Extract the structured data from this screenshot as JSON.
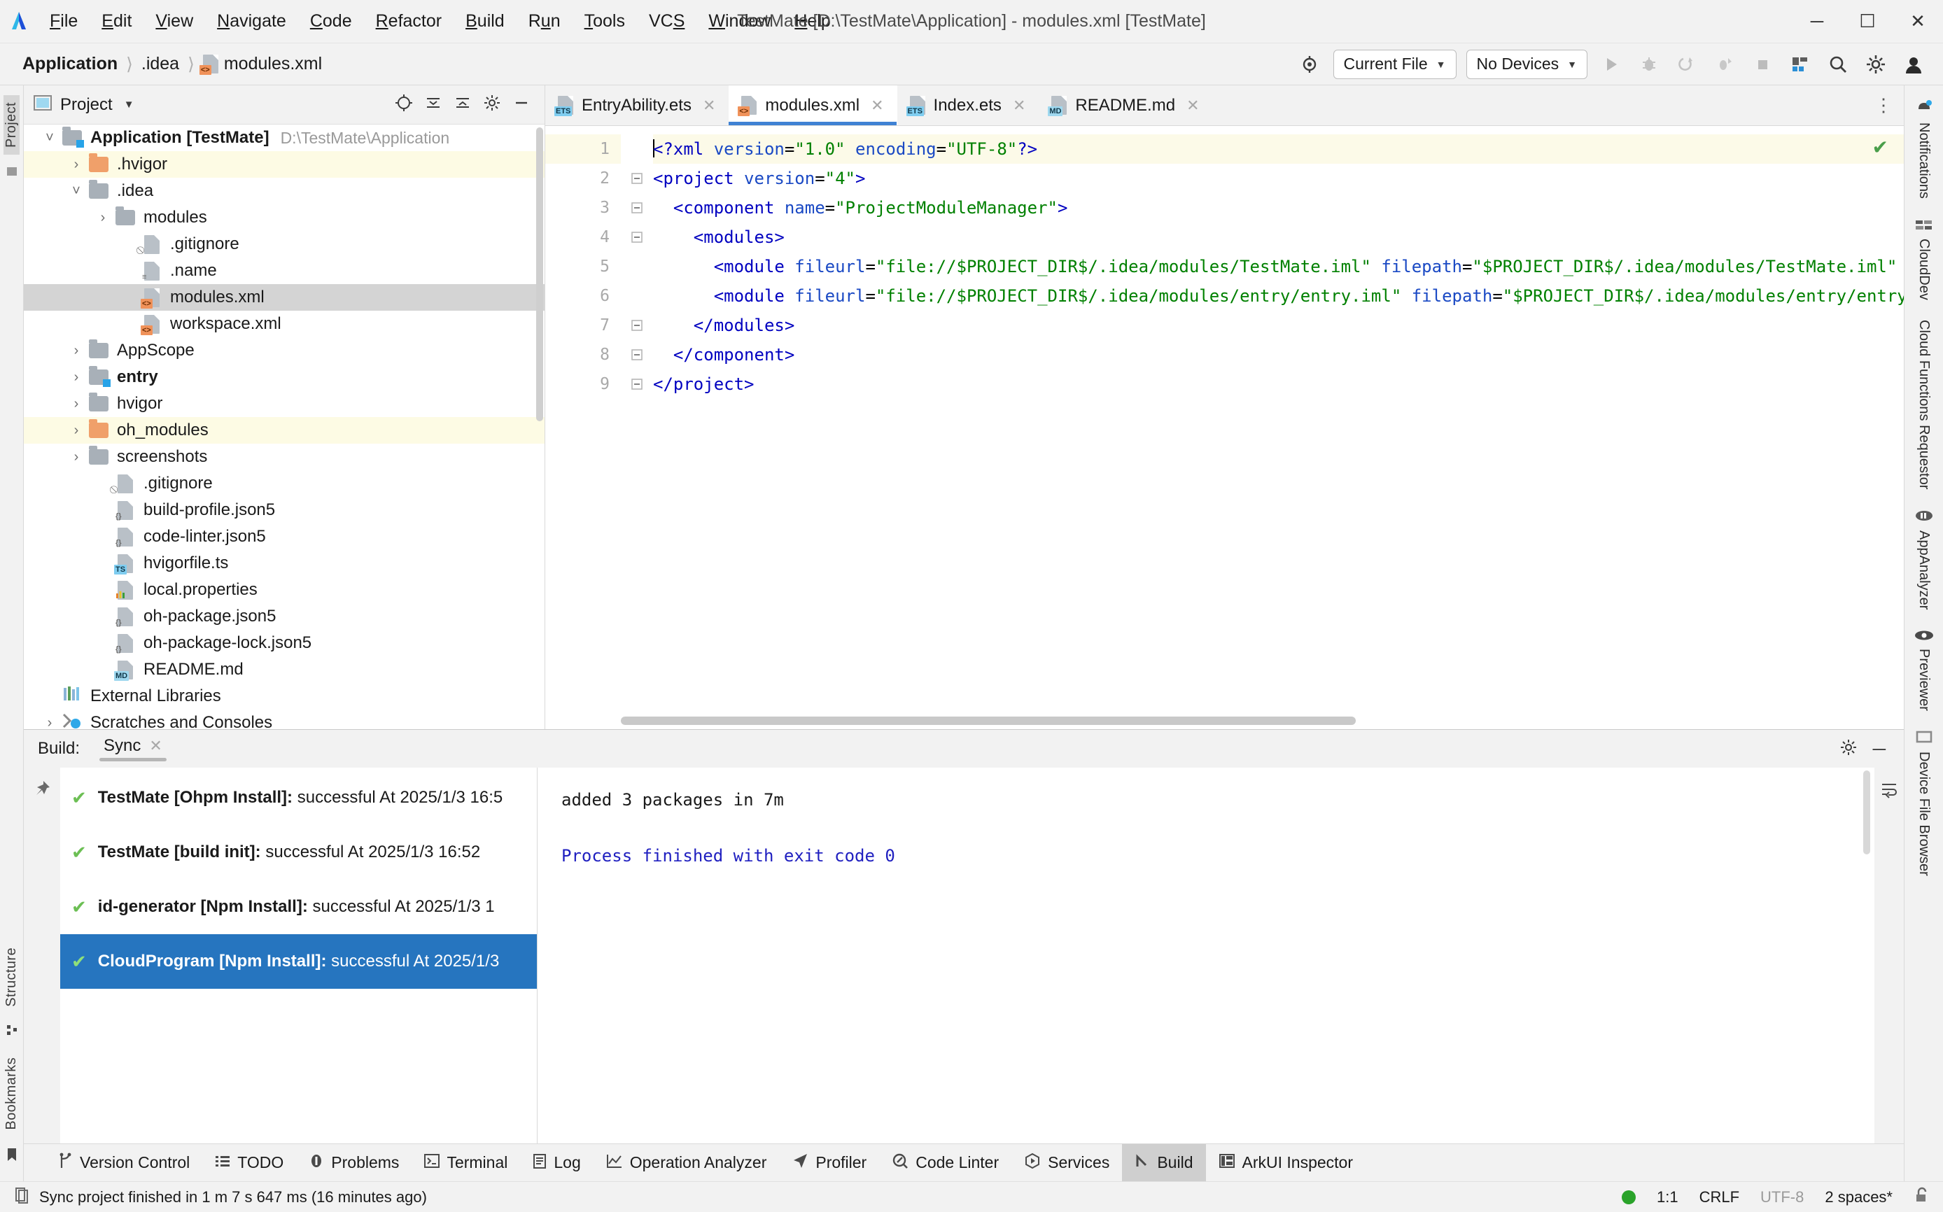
{
  "window": {
    "title": "TestMate [D:\\TestMate\\Application] - modules.xml [TestMate]",
    "minimize": "─",
    "maximize": "☐",
    "close": "✕"
  },
  "menubar": [
    {
      "label": "File"
    },
    {
      "label": "Edit"
    },
    {
      "label": "View"
    },
    {
      "label": "Navigate"
    },
    {
      "label": "Code"
    },
    {
      "label": "Refactor"
    },
    {
      "label": "Build"
    },
    {
      "label": "Run"
    },
    {
      "label": "Tools"
    },
    {
      "label": "VCS"
    },
    {
      "label": "Window"
    },
    {
      "label": "Help"
    }
  ],
  "breadcrumb": [
    {
      "label": "Application"
    },
    {
      "label": ".idea"
    },
    {
      "label": "modules.xml"
    }
  ],
  "toolbar": {
    "run_config": "Current File",
    "device": "No Devices",
    "caret": "▼"
  },
  "left_rail": {
    "project_label": "Project",
    "structure_label": "Structure",
    "bookmarks_label": "Bookmarks"
  },
  "project_panel": {
    "title": "Project",
    "tree": [
      {
        "depth": 0,
        "arrow": "˅",
        "icon": "folder-module",
        "name": "Application [TestMate]",
        "path": "D:\\TestMate\\Application",
        "bold": true,
        "state": "normal"
      },
      {
        "depth": 1,
        "arrow": "›",
        "icon": "folder-orange",
        "name": ".hvigor",
        "path": "",
        "bold": false,
        "state": "ignored"
      },
      {
        "depth": 1,
        "arrow": "˅",
        "icon": "folder",
        "name": ".idea",
        "path": "",
        "bold": false,
        "state": "normal"
      },
      {
        "depth": 2,
        "arrow": "›",
        "icon": "folder",
        "name": "modules",
        "path": "",
        "bold": false,
        "state": "normal"
      },
      {
        "depth": 3,
        "arrow": "",
        "icon": "file-gitignore",
        "name": ".gitignore",
        "path": "",
        "bold": false,
        "state": "normal"
      },
      {
        "depth": 3,
        "arrow": "",
        "icon": "file-text",
        "name": ".name",
        "path": "",
        "bold": false,
        "state": "normal"
      },
      {
        "depth": 3,
        "arrow": "",
        "icon": "file-xml",
        "name": "modules.xml",
        "path": "",
        "bold": false,
        "state": "selected"
      },
      {
        "depth": 3,
        "arrow": "",
        "icon": "file-xml",
        "name": "workspace.xml",
        "path": "",
        "bold": false,
        "state": "normal"
      },
      {
        "depth": 1,
        "arrow": "›",
        "icon": "folder",
        "name": "AppScope",
        "path": "",
        "bold": false,
        "state": "normal"
      },
      {
        "depth": 1,
        "arrow": "›",
        "icon": "folder-module",
        "name": "entry",
        "path": "",
        "bold": true,
        "state": "normal"
      },
      {
        "depth": 1,
        "arrow": "›",
        "icon": "folder",
        "name": "hvigor",
        "path": "",
        "bold": false,
        "state": "normal"
      },
      {
        "depth": 1,
        "arrow": "›",
        "icon": "folder-orange",
        "name": "oh_modules",
        "path": "",
        "bold": false,
        "state": "ignored"
      },
      {
        "depth": 1,
        "arrow": "›",
        "icon": "folder",
        "name": "screenshots",
        "path": "",
        "bold": false,
        "state": "normal"
      },
      {
        "depth": 2,
        "arrow": "",
        "icon": "file-gitignore",
        "name": ".gitignore",
        "path": "",
        "bold": false,
        "state": "normal"
      },
      {
        "depth": 2,
        "arrow": "",
        "icon": "file-json5",
        "name": "build-profile.json5",
        "path": "",
        "bold": false,
        "state": "normal"
      },
      {
        "depth": 2,
        "arrow": "",
        "icon": "file-json5",
        "name": "code-linter.json5",
        "path": "",
        "bold": false,
        "state": "normal"
      },
      {
        "depth": 2,
        "arrow": "",
        "icon": "file-ts",
        "name": "hvigorfile.ts",
        "path": "",
        "bold": false,
        "state": "normal"
      },
      {
        "depth": 2,
        "arrow": "",
        "icon": "file-properties",
        "name": "local.properties",
        "path": "",
        "bold": false,
        "state": "normal"
      },
      {
        "depth": 2,
        "arrow": "",
        "icon": "file-json5",
        "name": "oh-package.json5",
        "path": "",
        "bold": false,
        "state": "normal"
      },
      {
        "depth": 2,
        "arrow": "",
        "icon": "file-json5",
        "name": "oh-package-lock.json5",
        "path": "",
        "bold": false,
        "state": "normal"
      },
      {
        "depth": 2,
        "arrow": "",
        "icon": "file-md",
        "name": "README.md",
        "path": "",
        "bold": false,
        "state": "normal"
      },
      {
        "depth": 0,
        "arrow": "",
        "icon": "libraries",
        "name": "External Libraries",
        "path": "",
        "bold": false,
        "state": "normal"
      },
      {
        "depth": 0,
        "arrow": "›",
        "icon": "scratches",
        "name": "Scratches and Consoles",
        "path": "",
        "bold": false,
        "state": "normal"
      }
    ]
  },
  "editor": {
    "tabs": [
      {
        "label": "EntryAbility.ets",
        "icon": "file-ets",
        "active": false,
        "close": "✕"
      },
      {
        "label": "modules.xml",
        "icon": "file-xml",
        "active": true,
        "close": "✕"
      },
      {
        "label": "Index.ets",
        "icon": "file-ets",
        "active": false,
        "close": "✕"
      },
      {
        "label": "README.md",
        "icon": "file-md",
        "active": false,
        "close": "✕"
      }
    ],
    "inspection_ok": "✔",
    "lines": [
      {
        "n": "1",
        "fold": "",
        "current": true,
        "caret": true,
        "parts": [
          {
            "t": "<?",
            "c": "k-tag"
          },
          {
            "t": "xml",
            "c": "k-tag"
          },
          {
            "t": " ",
            "c": "k-punct"
          },
          {
            "t": "version",
            "c": "k-attr"
          },
          {
            "t": "=",
            "c": "k-punct"
          },
          {
            "t": "\"1.0\"",
            "c": "k-val"
          },
          {
            "t": " ",
            "c": "k-punct"
          },
          {
            "t": "encoding",
            "c": "k-attr"
          },
          {
            "t": "=",
            "c": "k-punct"
          },
          {
            "t": "\"UTF-8\"",
            "c": "k-val"
          },
          {
            "t": "?>",
            "c": "k-tag"
          }
        ]
      },
      {
        "n": "2",
        "fold": "⊟",
        "current": false,
        "caret": false,
        "parts": [
          {
            "t": "<project",
            "c": "k-tag"
          },
          {
            "t": " ",
            "c": "k-punct"
          },
          {
            "t": "version",
            "c": "k-attr"
          },
          {
            "t": "=",
            "c": "k-punct"
          },
          {
            "t": "\"4\"",
            "c": "k-val"
          },
          {
            "t": ">",
            "c": "k-tag"
          }
        ]
      },
      {
        "n": "3",
        "fold": "⊟",
        "current": false,
        "caret": false,
        "parts": [
          {
            "t": "  <component",
            "c": "k-tag"
          },
          {
            "t": " ",
            "c": "k-punct"
          },
          {
            "t": "name",
            "c": "k-attr"
          },
          {
            "t": "=",
            "c": "k-punct"
          },
          {
            "t": "\"ProjectModuleManager\"",
            "c": "k-val"
          },
          {
            "t": ">",
            "c": "k-tag"
          }
        ]
      },
      {
        "n": "4",
        "fold": "⊟",
        "current": false,
        "caret": false,
        "parts": [
          {
            "t": "    <modules>",
            "c": "k-tag"
          }
        ]
      },
      {
        "n": "5",
        "fold": "",
        "current": false,
        "caret": false,
        "parts": [
          {
            "t": "      <module",
            "c": "k-tag"
          },
          {
            "t": " ",
            "c": "k-punct"
          },
          {
            "t": "fileurl",
            "c": "k-attr"
          },
          {
            "t": "=",
            "c": "k-punct"
          },
          {
            "t": "\"file://$PROJECT_DIR$/.idea/modules/TestMate.iml\"",
            "c": "k-val"
          },
          {
            "t": " ",
            "c": "k-punct"
          },
          {
            "t": "filepath",
            "c": "k-attr"
          },
          {
            "t": "=",
            "c": "k-punct"
          },
          {
            "t": "\"$PROJECT_DIR$/.idea/modules/TestMate.iml\"",
            "c": "k-val"
          },
          {
            "t": " />",
            "c": "k-tag"
          }
        ]
      },
      {
        "n": "6",
        "fold": "",
        "current": false,
        "caret": false,
        "parts": [
          {
            "t": "      <module",
            "c": "k-tag"
          },
          {
            "t": " ",
            "c": "k-punct"
          },
          {
            "t": "fileurl",
            "c": "k-attr"
          },
          {
            "t": "=",
            "c": "k-punct"
          },
          {
            "t": "\"file://$PROJECT_DIR$/.idea/modules/entry/entry.iml\"",
            "c": "k-val"
          },
          {
            "t": " ",
            "c": "k-punct"
          },
          {
            "t": "filepath",
            "c": "k-attr"
          },
          {
            "t": "=",
            "c": "k-punct"
          },
          {
            "t": "\"$PROJECT_DIR$/.idea/modules/entry/entry.iml\"",
            "c": "k-val"
          },
          {
            "t": " />",
            "c": "k-tag"
          }
        ]
      },
      {
        "n": "7",
        "fold": "⊟",
        "current": false,
        "caret": false,
        "parts": [
          {
            "t": "    </modules>",
            "c": "k-tag"
          }
        ]
      },
      {
        "n": "8",
        "fold": "⊟",
        "current": false,
        "caret": false,
        "parts": [
          {
            "t": "  </component>",
            "c": "k-tag"
          }
        ]
      },
      {
        "n": "9",
        "fold": "⊟",
        "current": false,
        "caret": false,
        "parts": [
          {
            "t": "</project>",
            "c": "k-tag"
          }
        ]
      }
    ]
  },
  "build_panel": {
    "label": "Build:",
    "tab": "Sync",
    "tab_close": "✕",
    "minimize": "─",
    "entries": [
      {
        "check": "✔",
        "name": "TestMate [Ohpm Install]:",
        "detail": " successful At 2025/1/3 16:5",
        "selected": false
      },
      {
        "check": "✔",
        "name": "TestMate [build init]:",
        "detail": " successful At 2025/1/3 16:52",
        "selected": false
      },
      {
        "check": "✔",
        "name": "id-generator [Npm Install]:",
        "detail": " successful At 2025/1/3 1",
        "selected": false
      },
      {
        "check": "✔",
        "name": "CloudProgram [Npm Install]:",
        "detail": " successful At 2025/1/3",
        "selected": true
      }
    ],
    "console": [
      {
        "text": "added 3 packages in 7m",
        "style": "normal"
      },
      {
        "text": "",
        "style": "normal"
      },
      {
        "text": "Process finished with exit code 0",
        "style": "blue"
      }
    ]
  },
  "toolstrip": [
    {
      "label": "Version Control",
      "icon": "branch-icon",
      "active": false
    },
    {
      "label": "TODO",
      "icon": "list-icon",
      "active": false
    },
    {
      "label": "Problems",
      "icon": "warning-icon",
      "active": false
    },
    {
      "label": "Terminal",
      "icon": "terminal-icon",
      "active": false
    },
    {
      "label": "Log",
      "icon": "log-icon",
      "active": false
    },
    {
      "label": "Operation Analyzer",
      "icon": "chart-icon",
      "active": false
    },
    {
      "label": "Profiler",
      "icon": "profiler-icon",
      "active": false
    },
    {
      "label": "Code Linter",
      "icon": "linter-icon",
      "active": false
    },
    {
      "label": "Services",
      "icon": "services-icon",
      "active": false
    },
    {
      "label": "Build",
      "icon": "build-icon",
      "active": true
    },
    {
      "label": "ArkUI Inspector",
      "icon": "inspector-icon",
      "active": false
    }
  ],
  "right_rail": [
    {
      "label": "Notifications",
      "icon": "bell-icon"
    },
    {
      "label": "CloudDev",
      "icon": "cloud-icon"
    },
    {
      "label": "Cloud Functions Requestor",
      "icon": ""
    },
    {
      "label": "AppAnalyzer",
      "icon": "analyzer-icon"
    },
    {
      "label": "Previewer",
      "icon": "eye-icon"
    },
    {
      "label": "Device File Browser",
      "icon": "device-icon"
    }
  ],
  "statusbar": {
    "message": "Sync project finished in 1 m 7 s 647 ms (16 minutes ago)",
    "position": "1:1",
    "line_ending": "CRLF",
    "encoding": "UTF-8",
    "indent": "2 spaces*"
  }
}
